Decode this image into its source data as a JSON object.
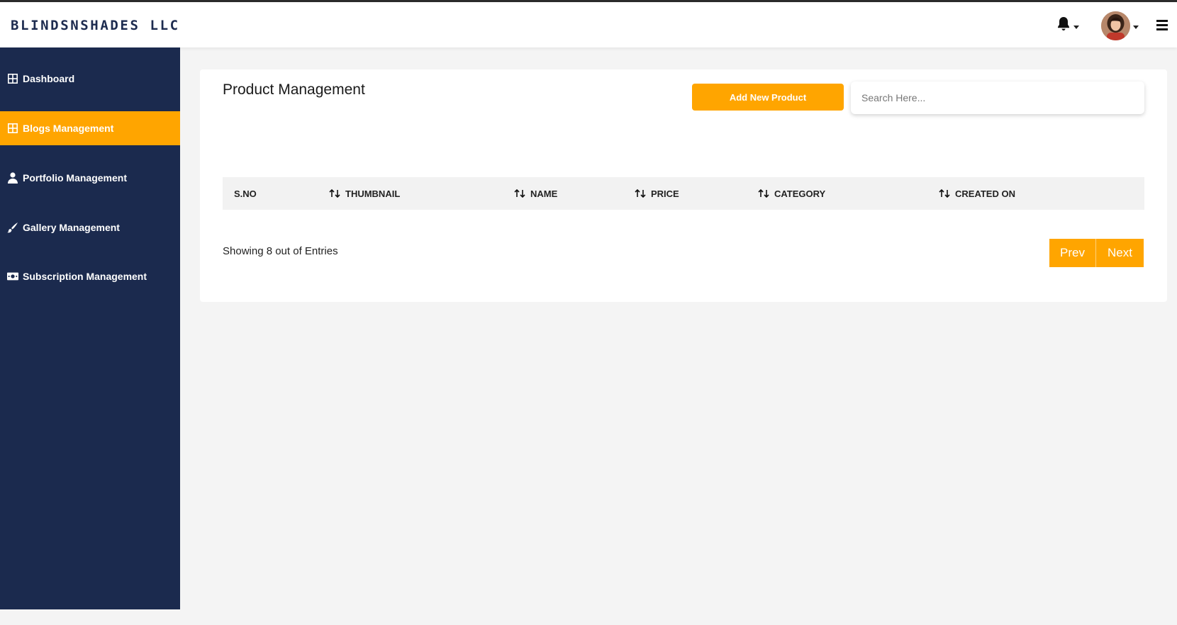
{
  "brand": "BLINDSNSHADES LLC",
  "header": {
    "notification_icon": "bell-icon",
    "menu_icon": "hamburger-icon",
    "avatar_icon": "user-avatar"
  },
  "sidebar": {
    "items": [
      {
        "label": "Dashboard",
        "icon": "grid-icon",
        "active": false
      },
      {
        "label": "Blogs Management",
        "icon": "grid-icon",
        "active": true
      },
      {
        "label": "Portfolio Management",
        "icon": "user-icon",
        "active": false
      },
      {
        "label": "Gallery Management",
        "icon": "brush-icon",
        "active": false
      },
      {
        "label": "Subscription Management",
        "icon": "money-icon",
        "active": false
      }
    ]
  },
  "main": {
    "title": "Product Management",
    "add_button": "Add New Product",
    "search_placeholder": "Search Here...",
    "columns": [
      "S.NO",
      "THUMBNAIL",
      "NAME",
      "PRICE",
      "CATEGORY",
      "CREATED ON"
    ],
    "showing_text": "Showing 8 out of Entries",
    "prev_label": "Prev",
    "next_label": "Next"
  },
  "colors": {
    "accent": "#ffa500",
    "sidebar_bg": "#1b2a4e",
    "page_bg": "#f4f4f4"
  }
}
